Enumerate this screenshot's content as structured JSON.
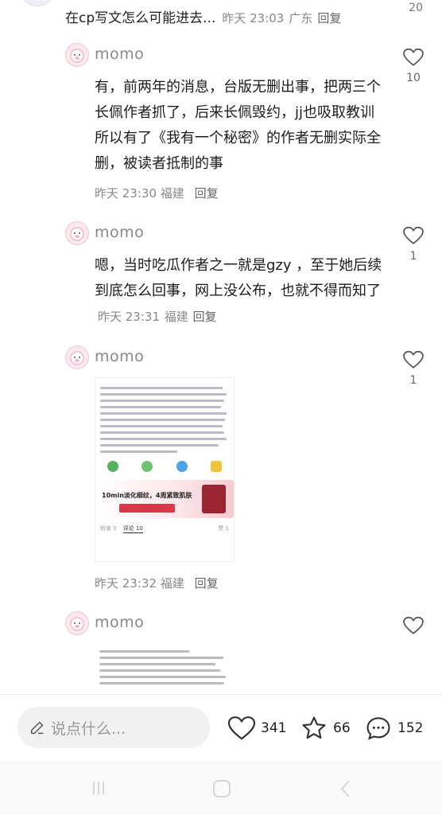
{
  "top": {
    "text": "在cp写文怎么可能进去...",
    "time": "昨天 23:03",
    "location": "广东",
    "reply": "回复",
    "like_count": "20"
  },
  "comments": [
    {
      "username": "momo",
      "text": "有，前两年的消息，台版无删出事，把两三个长佩作者抓了，后来长佩毁约，jj也吸取教训 所以有了《我有一个秘密》的作者无删实际全删，被读者抵制的事",
      "time": "昨天 23:30",
      "location": "福建",
      "reply": "回复",
      "like_count": "10"
    },
    {
      "username": "momo",
      "text": "嗯，当时吃瓜作者之一就是gzy ，至于她后续到底怎么回事，网上没公布，也就不得而知了",
      "time": "昨天 23:31",
      "location": "福建",
      "reply": "回复",
      "like_count": "1"
    },
    {
      "username": "momo",
      "time": "昨天 23:32",
      "location": "福建",
      "reply": "回复",
      "like_count": "1",
      "image": {
        "ad_text": "10min淡化细纹，4周紧致肌肤",
        "tabs": [
          "转发 0",
          "评论 10",
          "赞 1"
        ]
      }
    },
    {
      "username": "momo",
      "like_count": ""
    }
  ],
  "bottom_bar": {
    "input_placeholder": "说点什么...",
    "likes": "341",
    "collects": "66",
    "comments": "152"
  }
}
